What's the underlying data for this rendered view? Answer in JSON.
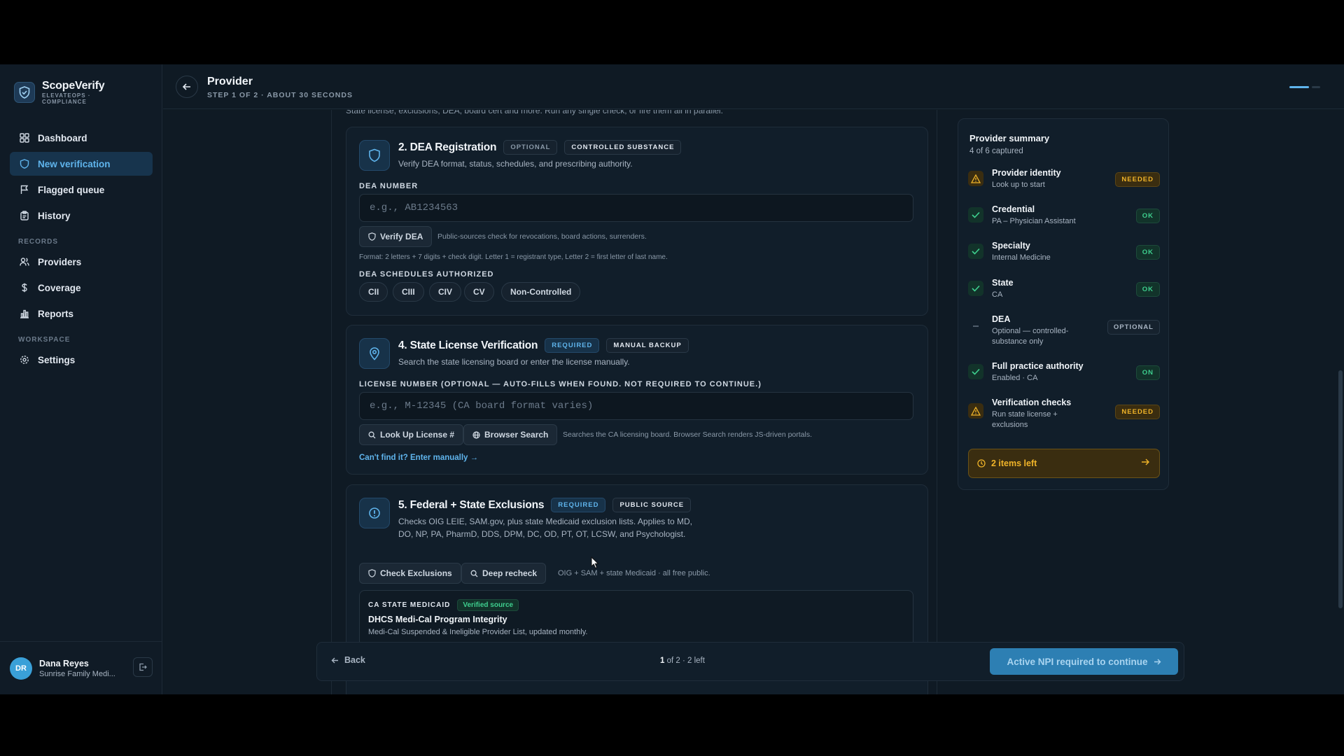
{
  "brand": {
    "name": "ScopeVerify",
    "sub": "ELEVATEOPS · COMPLIANCE"
  },
  "nav": {
    "items": [
      {
        "label": "Dashboard",
        "icon": "grid-icon"
      },
      {
        "label": "New verification",
        "icon": "shield-icon"
      },
      {
        "label": "Flagged queue",
        "icon": "flag-icon"
      },
      {
        "label": "History",
        "icon": "clipboard-icon"
      }
    ],
    "records_label": "RECORDS",
    "records": [
      {
        "label": "Providers",
        "icon": "users-icon"
      },
      {
        "label": "Coverage",
        "icon": "dollar-icon"
      },
      {
        "label": "Reports",
        "icon": "bar-chart-icon"
      }
    ],
    "workspace_label": "WORKSPACE",
    "workspace": [
      {
        "label": "Settings",
        "icon": "gear-icon"
      }
    ]
  },
  "user": {
    "initials": "DR",
    "name": "Dana Reyes",
    "org": "Sunrise Family Medi..."
  },
  "header": {
    "title": "Provider",
    "step": "STEP 1 OF 2 · ABOUT 30 SECONDS"
  },
  "intro_cut": "State license, exclusions, DEA, board cert and more. Run any single check, or fire them all in parallel.",
  "dea": {
    "title": "2. DEA Registration",
    "badge_optional": "OPTIONAL",
    "badge_tag": "CONTROLLED SUBSTANCE",
    "desc": "Verify DEA format, status, schedules, and prescribing authority.",
    "field_label": "DEA NUMBER",
    "placeholder": "e.g., AB1234563",
    "verify_button": "Verify DEA",
    "verify_hint": "Public-sources check for revocations, board actions, surrenders.",
    "format_hint": "Format: 2 letters + 7 digits + check digit. Letter 1 = registrant type, Letter 2 = first letter of last name.",
    "schedules_label": "DEA SCHEDULES AUTHORIZED",
    "schedules": [
      "CII",
      "CIII",
      "CIV",
      "CV",
      "Non-Controlled"
    ]
  },
  "license": {
    "title": "4. State License Verification",
    "badge_required": "REQUIRED",
    "badge_tag": "MANUAL BACKUP",
    "desc": "Search the state licensing board or enter the license manually.",
    "field_label": "LICENSE NUMBER (OPTIONAL — AUTO-FILLS WHEN FOUND. NOT REQUIRED TO CONTINUE.)",
    "placeholder": "e.g., M-12345 (CA board format varies)",
    "lookup_button": "Look Up License #",
    "browser_button": "Browser Search",
    "hint": "Searches the CA licensing board. Browser Search renders JS-driven portals.",
    "manual_link": "Can't find it? Enter manually →"
  },
  "exclusions": {
    "title": "5. Federal + State Exclusions",
    "badge_required": "REQUIRED",
    "badge_tag": "PUBLIC SOURCE",
    "desc": "Checks OIG LEIE, SAM.gov, plus state Medicaid exclusion lists. Applies to MD, DO, NP, PA, PharmD, DDS, DPM, DC, OD, PT, OT, LCSW, and Psychologist.",
    "check_button": "Check Exclusions",
    "deep_button": "Deep recheck",
    "hint": "OIG + SAM + state Medicaid · all free public.",
    "source_tag": "CA STATE MEDICAID",
    "source_badge": "Verified source",
    "source_title": "DHCS Medi-Cal Program Integrity",
    "source_desc": "Medi-Cal Suspended & Ineligible Provider List, updated monthly."
  },
  "summary": {
    "title": "Provider summary",
    "sub": "4 of 6 captured",
    "rows": [
      {
        "label": "Provider identity",
        "detail": "Look up to start",
        "badge": "NEEDED",
        "status": "warning"
      },
      {
        "label": "Credential",
        "detail": "PA – Physician Assistant",
        "badge": "OK",
        "status": "ok"
      },
      {
        "label": "Specialty",
        "detail": "Internal Medicine",
        "badge": "OK",
        "status": "ok"
      },
      {
        "label": "State",
        "detail": "CA",
        "badge": "OK",
        "status": "ok"
      },
      {
        "label": "DEA",
        "detail": "Optional — controlled-substance only",
        "badge": "OPTIONAL",
        "status": "optional"
      },
      {
        "label": "Full practice authority",
        "detail": "Enabled · CA",
        "badge": "ON",
        "status": "ok"
      },
      {
        "label": "Verification checks",
        "detail": "Run state license + exclusions",
        "badge": "NEEDED",
        "status": "warning"
      }
    ],
    "items_left": "2 items left"
  },
  "footer": {
    "back": "Back",
    "page": "1",
    "status_rest": " of 2 · 2 left",
    "cta": "Active NPI required to continue"
  },
  "colors": {
    "accent": "#5fb4ec",
    "ok": "#3ecf8e",
    "warning": "#f0b429",
    "background": "#0f1a24"
  }
}
